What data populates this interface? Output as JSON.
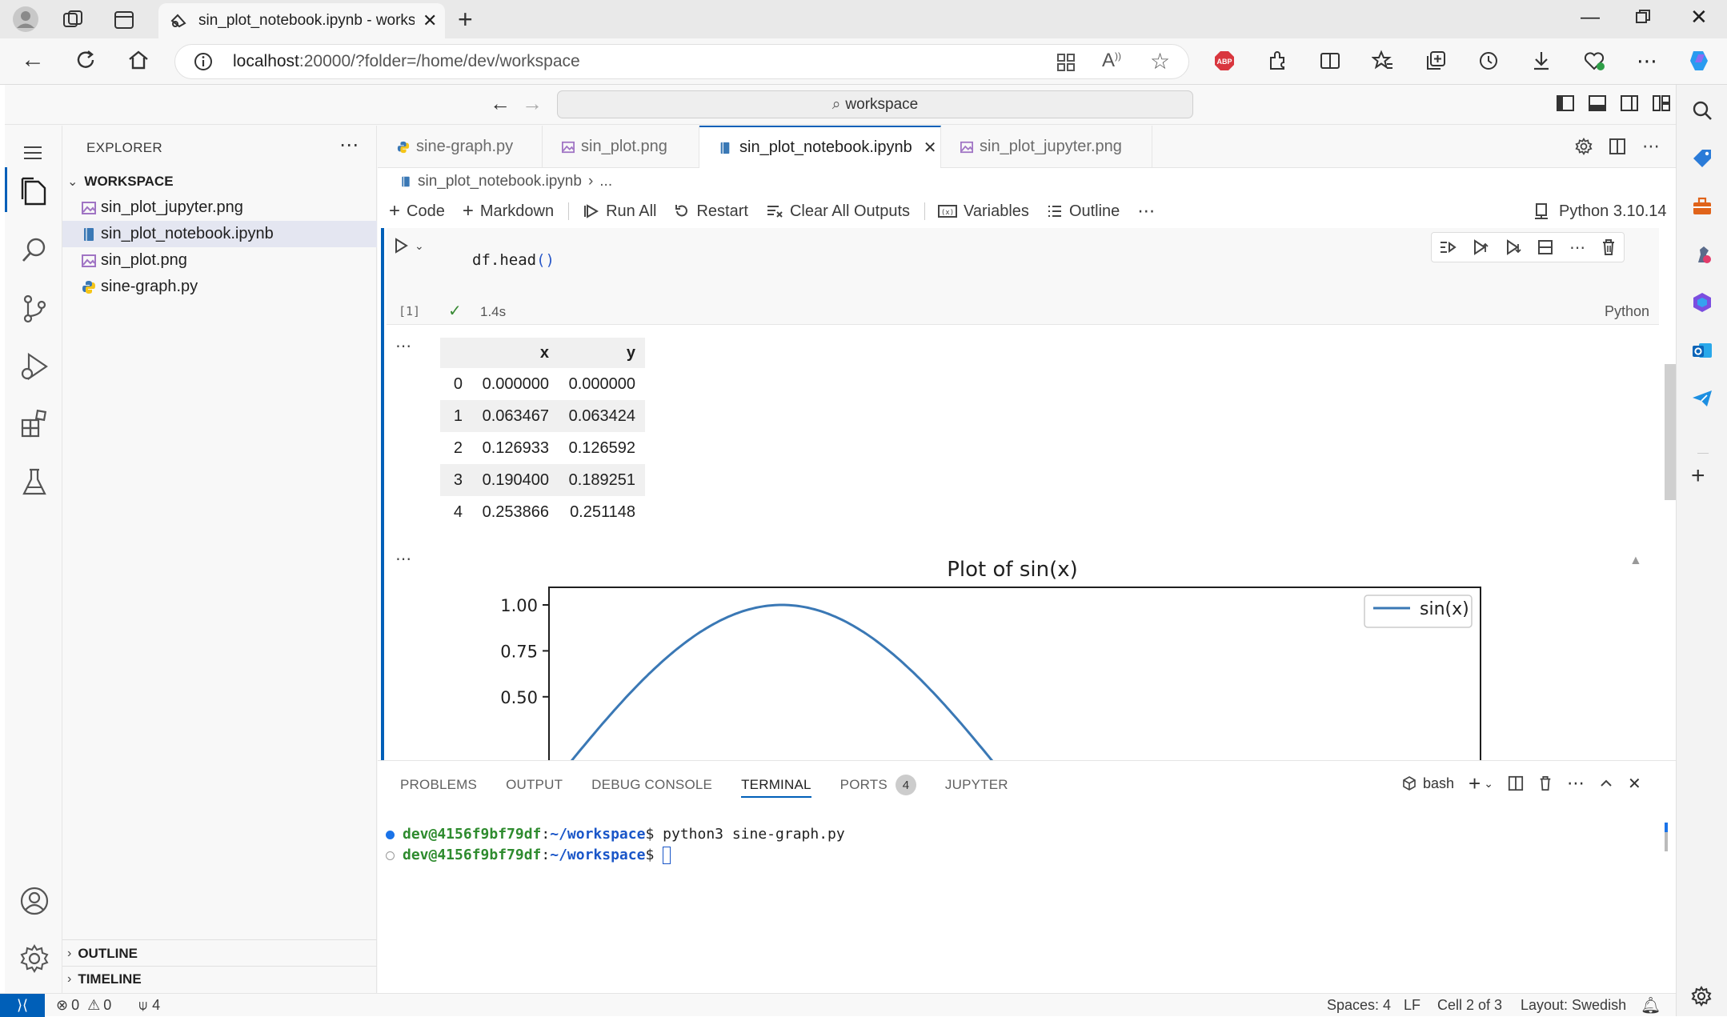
{
  "browser": {
    "tab_title": "sin_plot_notebook.ipynb - works",
    "url_host": "localhost",
    "url_rest": ":20000/?folder=/home/dev/workspace"
  },
  "titlebar": {
    "command_center": "workspace"
  },
  "sidebar": {
    "header": "EXPLORER",
    "folder": "WORKSPACE",
    "files": [
      {
        "name": "sin_plot_jupyter.png",
        "icon": "image-file-icon"
      },
      {
        "name": "sin_plot_notebook.ipynb",
        "icon": "notebook-file-icon"
      },
      {
        "name": "sin_plot.png",
        "icon": "image-file-icon"
      },
      {
        "name": "sine-graph.py",
        "icon": "python-file-icon"
      }
    ],
    "outline": "OUTLINE",
    "timeline": "TIMELINE"
  },
  "editor": {
    "tabs": [
      {
        "label": "sine-graph.py"
      },
      {
        "label": "sin_plot.png"
      },
      {
        "label": "sin_plot_notebook.ipynb"
      },
      {
        "label": "sin_plot_jupyter.png"
      }
    ],
    "breadcrumb": {
      "file": "sin_plot_notebook.ipynb",
      "more": "..."
    },
    "toolbar": {
      "code": "Code",
      "markdown": "Markdown",
      "run_all": "Run All",
      "restart": "Restart",
      "clear_outputs": "Clear All Outputs",
      "variables": "Variables",
      "outline": "Outline",
      "kernel": "Python 3.10.14"
    },
    "cell": {
      "code_prefix": "df.",
      "code_method": "head",
      "code_parens": "()",
      "exec_count": "[1]",
      "duration": "1.4s",
      "language": "Python"
    },
    "dataframe": {
      "columns": [
        "",
        "x",
        "y"
      ],
      "rows": [
        [
          "0",
          "0.000000",
          "0.000000"
        ],
        [
          "1",
          "0.063467",
          "0.063424"
        ],
        [
          "2",
          "0.126933",
          "0.126592"
        ],
        [
          "3",
          "0.190400",
          "0.189251"
        ],
        [
          "4",
          "0.253866",
          "0.251148"
        ]
      ]
    },
    "output_more": "..."
  },
  "chart_data": {
    "type": "line",
    "title": "Plot of sin(x)",
    "series": [
      {
        "name": "sin(x)",
        "function": "sin(x)",
        "x_range": [
          0,
          6.283
        ],
        "color": "#3a78b5"
      }
    ],
    "y_ticks": [
      "1.00",
      "0.75",
      "0.50"
    ],
    "ylim": [
      -1.1,
      1.1
    ],
    "legend": "top-right",
    "grid": false
  },
  "panel": {
    "tabs": [
      "PROBLEMS",
      "OUTPUT",
      "DEBUG CONSOLE",
      "TERMINAL",
      "PORTS",
      "JUPYTER"
    ],
    "ports_badge": "4",
    "shell": "bash",
    "terminal": [
      {
        "prompt": "dev@4156f9bf79df",
        "sep": ":",
        "path": "~/workspace",
        "dollar": "$ ",
        "cmd": "python3 sine-graph.py"
      },
      {
        "prompt": "dev@4156f9bf79df",
        "sep": ":",
        "path": "~/workspace",
        "dollar": "$ ",
        "cmd": ""
      }
    ]
  },
  "statusbar": {
    "errors": "0",
    "warnings": "0",
    "ports": "4",
    "spaces": "Spaces: 4",
    "eol": "LF",
    "cell": "Cell 2 of 3",
    "layout": "Layout: Swedish"
  },
  "colors": {
    "accent": "#005fb8",
    "status_remote": "#005fb8",
    "success": "#388a34",
    "terminal_green": "#2e8b2e",
    "terminal_blue": "#1a56c8"
  }
}
